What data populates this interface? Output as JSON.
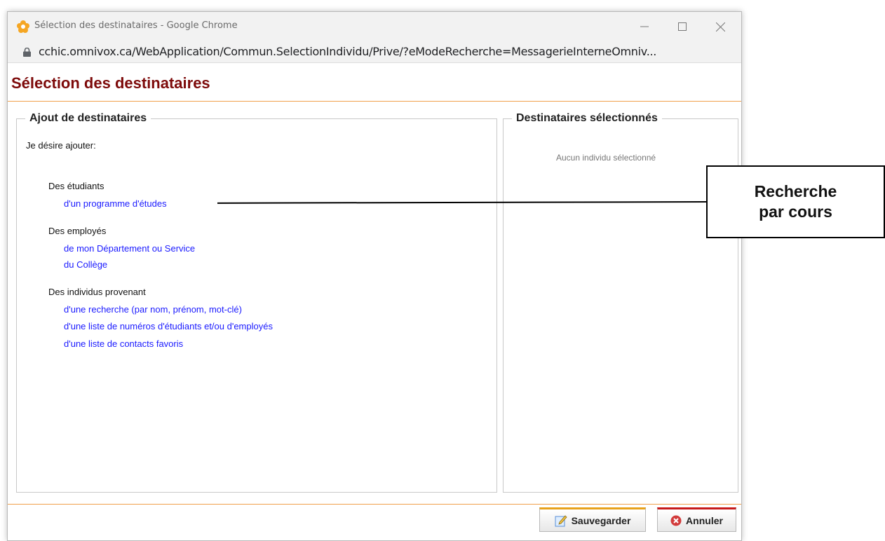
{
  "window": {
    "title": "Sélection des destinataires - Google Chrome",
    "url": "cchic.omnivox.ca/WebApplication/Commun.SelectionIndividu/Prive/?eModeRecherche=MessagerieInterneOmniv..."
  },
  "page": {
    "title": "Sélection des destinataires"
  },
  "left_panel": {
    "legend": "Ajout de destinataires",
    "intro": "Je désire ajouter:",
    "groups": [
      {
        "label": "Des étudiants",
        "links": [
          "d'un programme d'études"
        ]
      },
      {
        "label": "Des employés",
        "links": [
          "de mon Département ou Service",
          "du Collège"
        ]
      },
      {
        "label": "Des individus provenant",
        "links": [
          "d'une recherche (par nom, prénom, mot-clé)",
          "d'une liste de numéros d'étudiants et/ou d'employés",
          "d'une liste de contacts favoris"
        ]
      }
    ]
  },
  "right_panel": {
    "legend": "Destinataires sélectionnés",
    "empty_text": "Aucun individu sélectionné"
  },
  "buttons": {
    "save": "Sauvegarder",
    "cancel": "Annuler"
  },
  "callout": {
    "line1": "Recherche",
    "line2": "par cours"
  },
  "colors": {
    "title": "#7d0a0a",
    "link": "#1a1aff",
    "accent_rule": "#f0a04a",
    "save_accent": "#e8a21b",
    "cancel_accent": "#c81b1b"
  },
  "icons": [
    "app-flower-icon",
    "minimize-icon",
    "maximize-icon",
    "close-icon",
    "lock-icon",
    "edit-icon",
    "cancel-circle-icon"
  ]
}
